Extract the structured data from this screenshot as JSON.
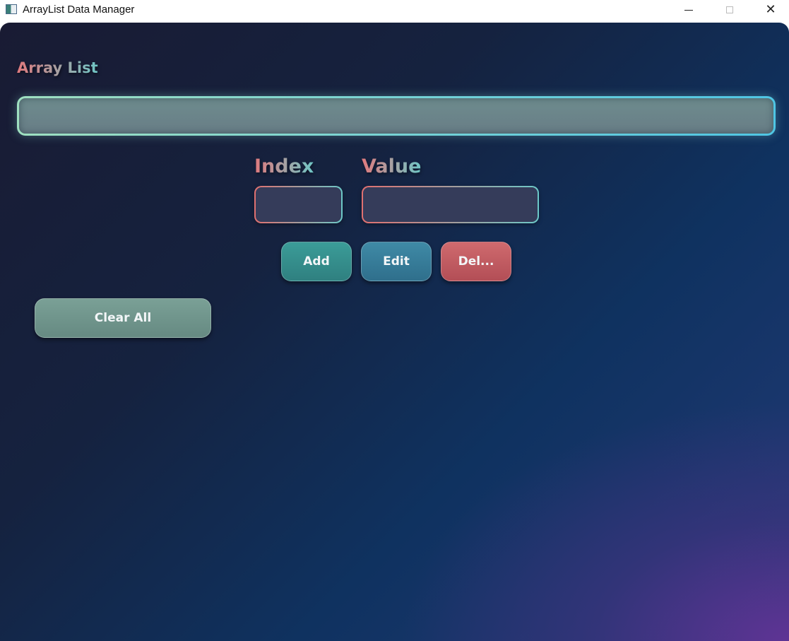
{
  "window": {
    "title": "ArrayList Data Manager",
    "controls": {
      "minimize": "minimize",
      "maximize": "maximize",
      "close": "✕"
    }
  },
  "list": {
    "title": "Array List",
    "items": []
  },
  "fields": {
    "index_label": "Index",
    "index_value": "",
    "value_label": "Value",
    "value_value": ""
  },
  "buttons": {
    "add": "Add",
    "edit": "Edit",
    "delete": "Del...",
    "clear_all": "Clear All"
  },
  "colors": {
    "accent_teal": "#3b9c98",
    "accent_blue": "#3f8aa6",
    "accent_red": "#cf6a6e",
    "clear_green": "#7aa096",
    "label_gradient_start": "#e07a7e",
    "label_gradient_end": "#6fc6c6"
  }
}
